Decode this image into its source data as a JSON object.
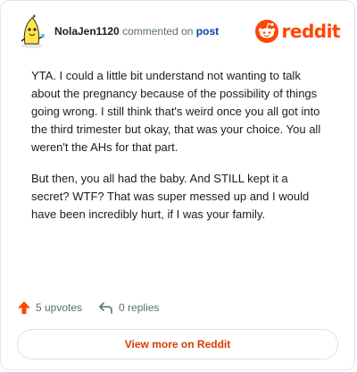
{
  "header": {
    "username": "NolaJen1120",
    "action_text": "commented on",
    "post_link": "post",
    "brand": "reddit"
  },
  "comment": {
    "paragraphs": [
      "YTA. I could a little bit understand not wanting to talk about the pregnancy because of the possibility of things going wrong. I still think that's weird once you all got into the third trimester but okay, that was your choice. You all weren't the AHs for that part.",
      "But then, you all had the baby. And STILL kept it a secret? WTF? That was super messed up and I would have been incredibly hurt, if I was your family."
    ]
  },
  "actions": {
    "upvotes": "5 upvotes",
    "replies": "0 replies"
  },
  "footer": {
    "view_more": "View more on Reddit"
  },
  "colors": {
    "brand": "#ff4500",
    "link": "#0045ac",
    "view_more": "#d93a00",
    "muted": "#576f76"
  },
  "icons": {
    "avatar": "banana-avatar-icon",
    "logo": "reddit-snoo-icon",
    "upvote": "upvote-arrow-icon",
    "reply": "reply-arrow-icon"
  }
}
